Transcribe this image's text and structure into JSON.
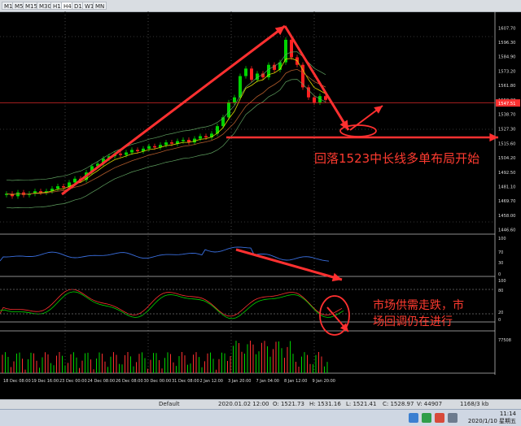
{
  "toolbar": {
    "timeframes": [
      "M1",
      "M5",
      "M15",
      "M30",
      "H1",
      "H4",
      "D1",
      "W1",
      "MN"
    ],
    "active": "H4"
  },
  "price_axis": [
    "1607.70",
    "1596.30",
    "1584.90",
    "1573.20",
    "1561.80",
    "1550.20",
    "1547.51",
    "1538.70",
    "1527.30",
    "1515.60",
    "1504.20",
    "1492.50",
    "1481.10",
    "1469.70",
    "1458.00",
    "1446.60"
  ],
  "current_price": "1547.51",
  "rsi_axis": [
    "100",
    "70",
    "30",
    "0"
  ],
  "stoch_axis": [
    "100",
    "80",
    "20",
    "0"
  ],
  "volume_axis": "77508",
  "time_axis": [
    "18 Dec 08:00",
    "19 Dec 16:00",
    "23 Dec 00:00",
    "24 Dec 08:00",
    "26 Dec 08:00",
    "30 Dec 00:00",
    "31 Dec 08:00",
    "2 Jan 12:00",
    "3 Jan 20:00",
    "7 Jan 04:00",
    "8 Jan 12:00",
    "9 Jan 20:00"
  ],
  "annotations": {
    "main": "回落1523中长线多单布局开始",
    "sub_line1": "市场供需走跌，市",
    "sub_line2": "场回调仍在进行"
  },
  "statusbar": {
    "profile": "Default",
    "datetime": "2020.01.02 12:00",
    "open": "O: 1521.73",
    "high": "H: 1531.16",
    "low": "L: 1521.41",
    "close": "C: 1528.97",
    "volume": "V: 44907",
    "traffic": "1168/3 kb"
  },
  "clock": {
    "time": "11:14",
    "date": "2020/1/10 星期五"
  },
  "colors": {
    "bull": "#00d400",
    "bear": "#ff2020",
    "arrow": "#ff3030",
    "ma_yellow": "#d7d700",
    "ma_green": "#5fa05f",
    "rsi": "#3a6fe0"
  }
}
